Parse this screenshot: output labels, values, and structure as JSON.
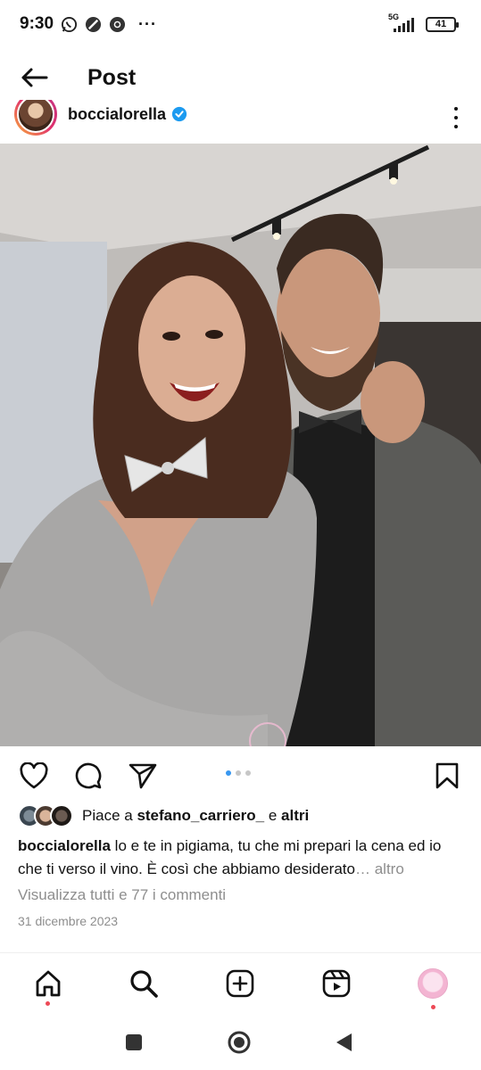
{
  "status_bar": {
    "time": "9:30",
    "network": "5G",
    "battery": "41",
    "more": "···"
  },
  "header": {
    "title": "Post"
  },
  "post": {
    "username": "boccialorella",
    "likes": {
      "prefix": "Piace a ",
      "user": "stefano_carriero_",
      "middle": " e ",
      "others": "altri"
    },
    "caption": {
      "author": "boccialorella",
      "text": " lo e te in pigiama, tu che mi prepari la cena ed io che ti verso il vino. È così che abbiamo desiderato",
      "more": "… altro"
    },
    "view_comments": "Visualizza tutti e 77 i commenti",
    "date": "31 dicembre 2023",
    "carousel": {
      "count": 3,
      "active_index": 0
    }
  },
  "icons": {
    "back": "back-arrow-icon",
    "like": "heart-icon",
    "comment": "comment-icon",
    "share": "send-icon",
    "save": "bookmark-icon",
    "more": "more-options-icon",
    "verified": "verified-badge-icon"
  },
  "colors": {
    "accent": "#3897f0",
    "verified": "#1d9bf0",
    "notification_dot": "#ed4956",
    "secondary_text": "#8e8e8e"
  }
}
